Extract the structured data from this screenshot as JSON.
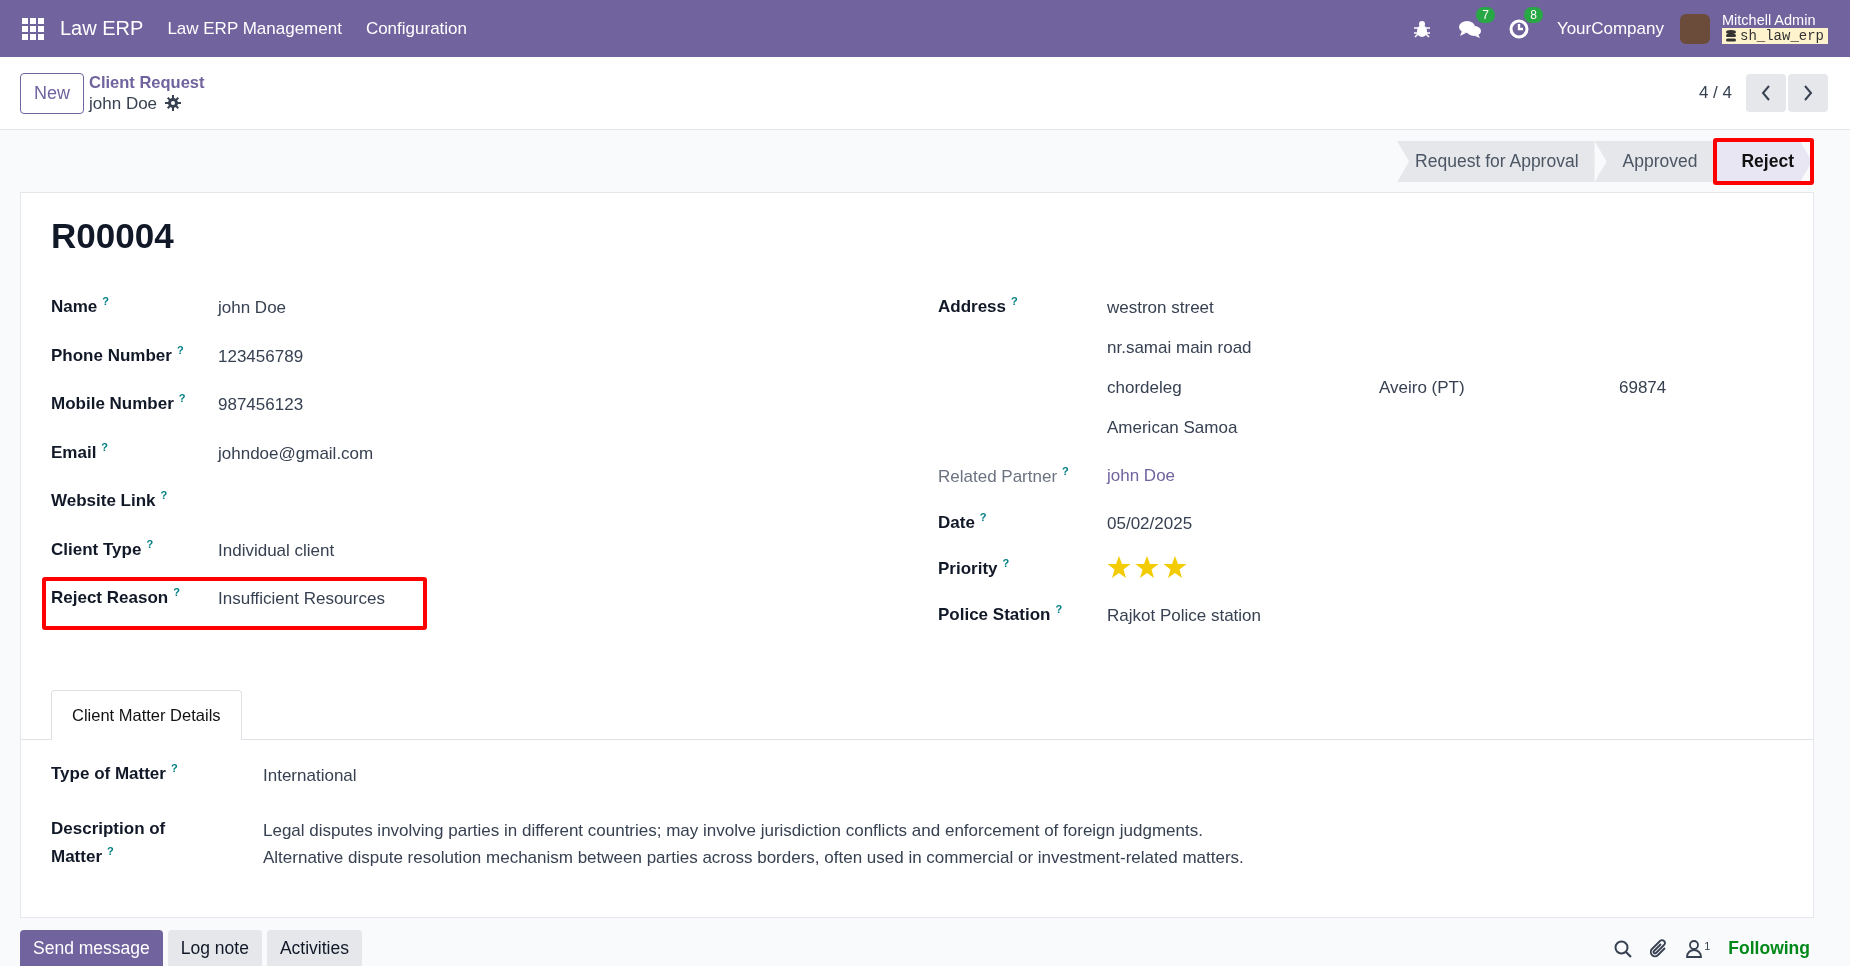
{
  "navbar": {
    "app_name": "Law ERP",
    "menus": [
      "Law ERP Management",
      "Configuration"
    ],
    "messages_count": "7",
    "activities_count": "8",
    "company": "YourCompany",
    "user": "Mitchell Admin",
    "database": "sh_law_erp"
  },
  "control_panel": {
    "new_button": "New",
    "breadcrumb": "Client Request",
    "record_name": "john Doe",
    "pager": "4 / 4"
  },
  "statusbar": [
    {
      "label": "Request for Approval",
      "selected": false,
      "highlighted": false
    },
    {
      "label": "Approved",
      "selected": false,
      "highlighted": false
    },
    {
      "label": "Reject",
      "selected": true,
      "highlighted": true
    }
  ],
  "form": {
    "reference": "R00004",
    "left_fields": [
      {
        "label": "Name",
        "help": "?",
        "value": "john Doe",
        "highlighted": false
      },
      {
        "label": "Phone Number",
        "help": "?",
        "value": "123456789",
        "highlighted": false
      },
      {
        "label": "Mobile Number",
        "help": "?",
        "value": "987456123",
        "highlighted": false
      },
      {
        "label": "Email",
        "help": "?",
        "value": "johndoe@gmail.com",
        "highlighted": false
      },
      {
        "label": "Website Link",
        "help": "?",
        "highlighted": false
      },
      {
        "label": "Client Type",
        "help": "?",
        "value": "Individual client",
        "highlighted": false
      },
      {
        "label": "Reject Reason",
        "help": "?",
        "value": "Insufficient Resources",
        "highlighted": true
      }
    ],
    "right_fields": [
      {
        "kind": "address",
        "label": "Address",
        "help": "?",
        "lines": [
          [
            "westron street"
          ],
          [
            "nr.samai main road"
          ],
          [
            "chordeleg",
            "Aveiro (PT)",
            "69874"
          ],
          [
            "American Samoa"
          ]
        ]
      },
      {
        "kind": "link",
        "label": "Related Partner",
        "help": "?",
        "value": "john Doe"
      },
      {
        "kind": "text",
        "label": "Date",
        "help": "?",
        "value": "05/02/2025"
      },
      {
        "kind": "stars",
        "label": "Priority",
        "help": "?",
        "stars": 3
      },
      {
        "kind": "text",
        "label": "Police Station",
        "help": "?",
        "value": "Rajkot Police station"
      }
    ],
    "tabs": [
      {
        "label": "Client Matter Details",
        "selected": true
      }
    ],
    "matter_fields": [
      {
        "label": "Type of Matter",
        "help": "?",
        "lines": [
          "International"
        ]
      },
      {
        "label": "Description of Matter",
        "help": "?",
        "lines": [
          "Legal disputes involving parties in different countries; may involve jurisdiction conflicts and enforcement of foreign judgments.",
          "Alternative dispute resolution mechanism between parties across borders, often used in commercial or investment-related matters."
        ]
      }
    ]
  },
  "chatter": {
    "buttons": [
      {
        "label": "Send message",
        "selected": true
      },
      {
        "label": "Log note",
        "selected": false
      },
      {
        "label": "Activities",
        "selected": false
      }
    ],
    "followers_count": "1",
    "follow_status": "Following"
  }
}
